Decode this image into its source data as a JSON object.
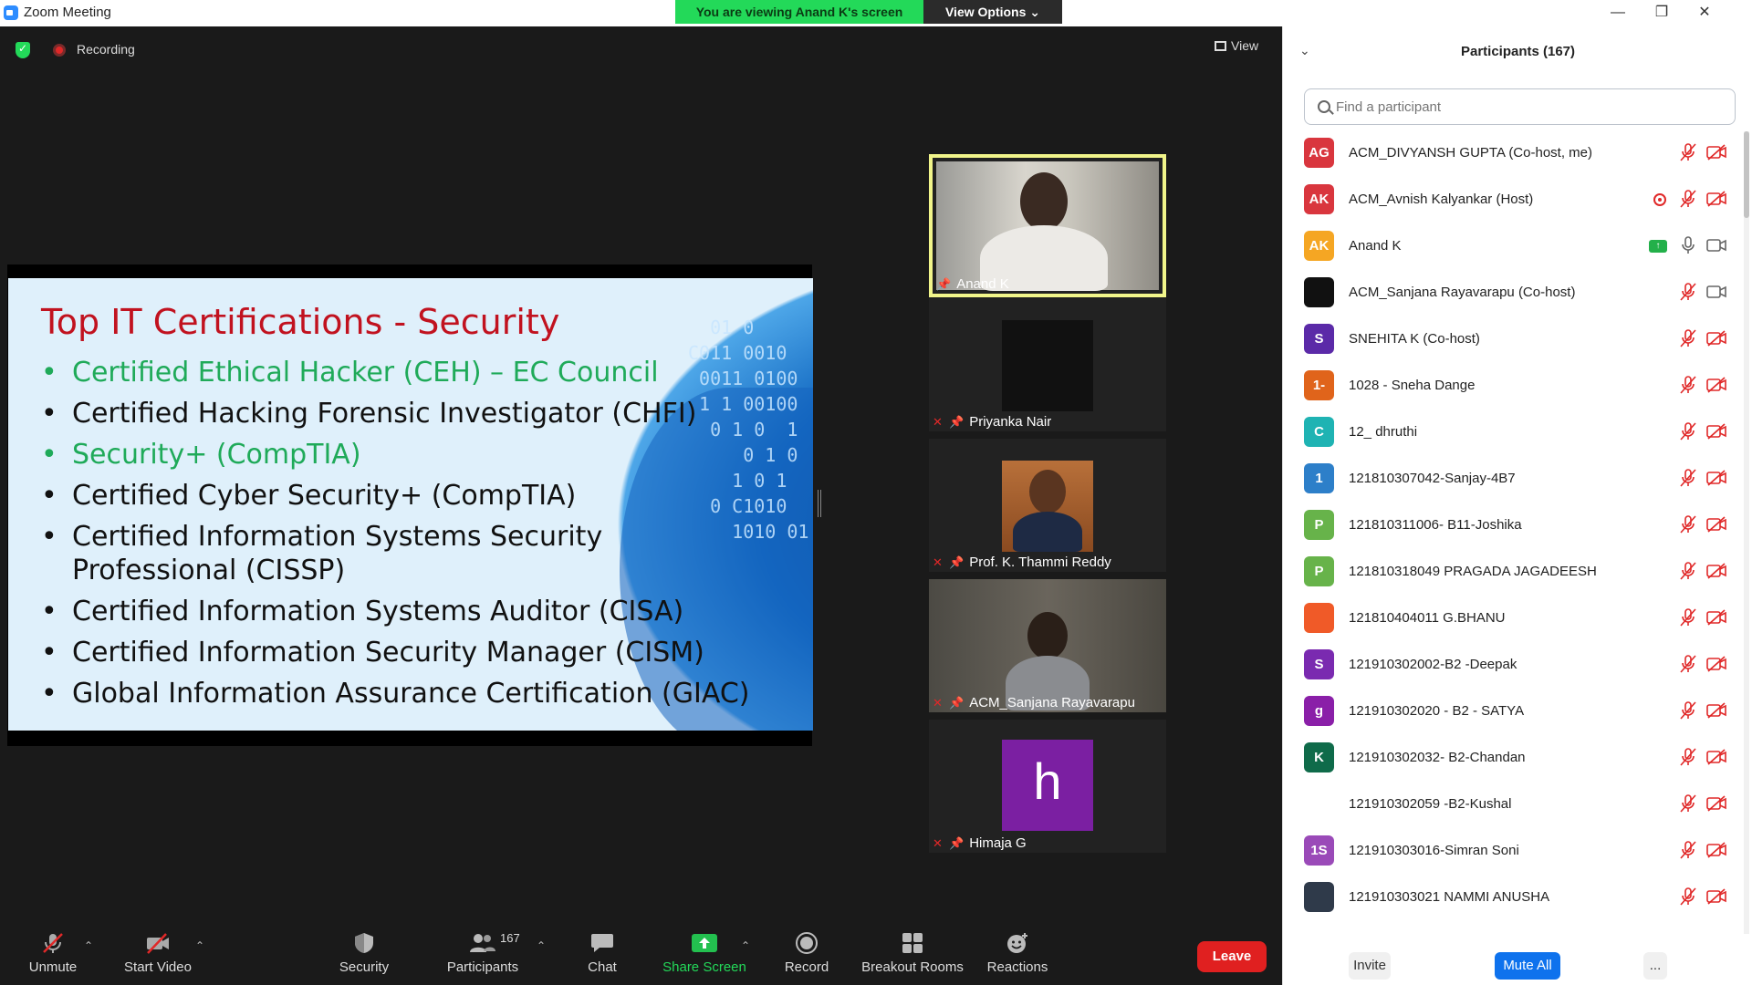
{
  "window": {
    "title": "Zoom Meeting"
  },
  "banner": {
    "viewing": "You are viewing Anand K's screen",
    "view_options": "View Options ⌄"
  },
  "status": {
    "recording_label": "Recording",
    "view_label": "View"
  },
  "slide": {
    "title": "Top IT Certifications - Security",
    "items": [
      {
        "text": "Certified Ethical Hacker (CEH) – EC Council",
        "highlight": true
      },
      {
        "text": "Certified Hacking Forensic Investigator (CHFI)",
        "highlight": false
      },
      {
        "text": "Security+ (CompTIA)",
        "highlight": true
      },
      {
        "text": "Certified Cyber Security+ (CompTIA)",
        "highlight": false
      },
      {
        "text": "Certified Information Systems Security Professional (CISSP)",
        "highlight": false
      },
      {
        "text": "Certified Information Systems Auditor (CISA)",
        "highlight": false
      },
      {
        "text": "Certified Information Security Manager (CISM)",
        "highlight": false
      },
      {
        "text": "Global Information Assurance Certification (GIAC)",
        "highlight": false
      }
    ]
  },
  "tiles": [
    {
      "name": "Anand K",
      "active": true
    },
    {
      "name": "Priyanka Nair",
      "active": false
    },
    {
      "name": "Prof. K. Thammi Reddy",
      "active": false
    },
    {
      "name": "ACM_Sanjana Rayavarapu",
      "active": false
    },
    {
      "name": "Himaja G",
      "active": false,
      "initial": "h"
    }
  ],
  "toolbar": {
    "unmute": "Unmute",
    "start_video": "Start Video",
    "security": "Security",
    "participants": "Participants",
    "participants_count": "167",
    "chat": "Chat",
    "share_screen": "Share Screen",
    "record": "Record",
    "breakout_rooms": "Breakout Rooms",
    "reactions": "Reactions",
    "leave": "Leave"
  },
  "panel": {
    "title": "Participants (167)",
    "search_placeholder": "Find a participant",
    "invite": "Invite",
    "mute_all": "Mute All",
    "more": "..."
  },
  "participants": [
    {
      "initials": "AG",
      "name": "ACM_DIVYANSH GUPTA (Co-host, me)",
      "color": "#d9363e",
      "mic": "off",
      "cam": "off"
    },
    {
      "initials": "AK",
      "name": "ACM_Avnish Kalyankar (Host)",
      "color": "#d9363e",
      "mic": "off",
      "cam": "off",
      "recording": true
    },
    {
      "initials": "AK",
      "name": "Anand K",
      "color": "#f5a623",
      "mic": "on",
      "cam": "on",
      "sharing": true
    },
    {
      "initials": "",
      "name": "ACM_Sanjana Rayavarapu (Co-host)",
      "color": "#111111",
      "mic": "off",
      "cam": "on"
    },
    {
      "initials": "S",
      "name": "SNEHITA K (Co-host)",
      "color": "#5b2aa8",
      "mic": "off",
      "cam": "off"
    },
    {
      "initials": "1-",
      "name": "1028 - Sneha Dange",
      "color": "#e0641b",
      "mic": "off",
      "cam": "off"
    },
    {
      "initials": "C",
      "name": "12_ dhruthi",
      "color": "#1fb3b3",
      "mic": "off",
      "cam": "off"
    },
    {
      "initials": "1",
      "name": "121810307042-Sanjay-4B7",
      "color": "#2d7fc9",
      "mic": "off",
      "cam": "off"
    },
    {
      "initials": "P",
      "name": "121810311006- B11-Joshika",
      "color": "#67b34a",
      "mic": "off",
      "cam": "off"
    },
    {
      "initials": "P",
      "name": "121810318049 PRAGADA JAGADEESH",
      "color": "#67b34a",
      "mic": "off",
      "cam": "off"
    },
    {
      "initials": "",
      "name": "121810404011 G.BHANU",
      "color": "#f05a28",
      "mic": "off",
      "cam": "off"
    },
    {
      "initials": "S",
      "name": "121910302002-B2 -Deepak",
      "color": "#7a2ab0",
      "mic": "off",
      "cam": "off"
    },
    {
      "initials": "g",
      "name": "121910302020 - B2 - SATYA",
      "color": "#8a1fa8",
      "mic": "off",
      "cam": "off"
    },
    {
      "initials": "K",
      "name": "121910302032- B2-Chandan",
      "color": "#0f6b4a",
      "mic": "off",
      "cam": "off"
    },
    {
      "initials": "",
      "name": "121910302059 -B2-Kushal",
      "color": "#ffffff",
      "mic": "off",
      "cam": "off"
    },
    {
      "initials": "1S",
      "name": "121910303016-Simran Soni",
      "color": "#9a4ab8",
      "mic": "off",
      "cam": "off"
    },
    {
      "initials": "",
      "name": "121910303021 NAMMI ANUSHA",
      "color": "#2f3a4a",
      "mic": "off",
      "cam": "off"
    }
  ]
}
